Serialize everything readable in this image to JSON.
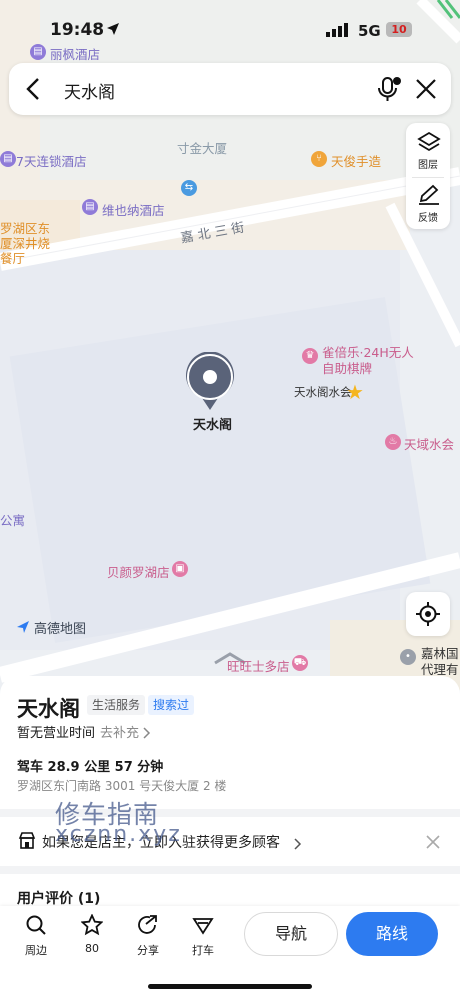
{
  "status_bar": {
    "time": "19:48",
    "network": "5G",
    "battery": "10"
  },
  "search": {
    "query": "天水阁"
  },
  "map": {
    "roads": [
      "嘉 北 三 街"
    ],
    "labels": {
      "top_left_hotel": "丽枫酒店",
      "chain_hotel": "7天连锁酒店",
      "building": "寸金大厦",
      "food": "天俊手造",
      "hotel2": "维也纳酒店",
      "district_l1": "罗湖区东",
      "district_l2": "厦深井烧",
      "district_l3": "餐厅",
      "chess_l1": "雀倍乐·24H无人",
      "chess_l2": "自助棋牌",
      "star_poi": "天水阁水会",
      "spa": "天域水会",
      "apartment": "公寓",
      "beauty": "贝颜罗湖店",
      "shop": "旺旺士多店",
      "right_poi_l1": "嘉林国",
      "right_poi_l2": "代理有",
      "logo": "高德地图",
      "pin_label": "天水阁"
    },
    "tools": {
      "layers": "图层",
      "feedback": "反馈"
    }
  },
  "place": {
    "name": "天水阁",
    "category_tag": "生活服务",
    "visited_tag": "搜索过",
    "hours": "暂无营业时间",
    "hours_link": "去补充",
    "drive_info": "驾车 28.9 公里  57 分钟",
    "address": "罗湖区东门南路 3001 号天俊大厦 2 楼",
    "owner_banner": "如果您是店主，立即入驻获得更多顾客",
    "reviews_heading": "用户评价 (1)"
  },
  "watermark": {
    "line1": "修车指南",
    "line2": "xcznn.xyz"
  },
  "bottom_bar": {
    "nearby": "周边",
    "favorites_count": "80",
    "share": "分享",
    "taxi": "打车",
    "navigate": "导航",
    "route": "路线"
  },
  "colors": {
    "accent": "#2d7bf0",
    "pin": "#5a6379",
    "poi_purple": "#8f7bd8",
    "poi_pink": "#e27aa6",
    "poi_orange": "#f0a53a",
    "road": "#ffffff"
  }
}
